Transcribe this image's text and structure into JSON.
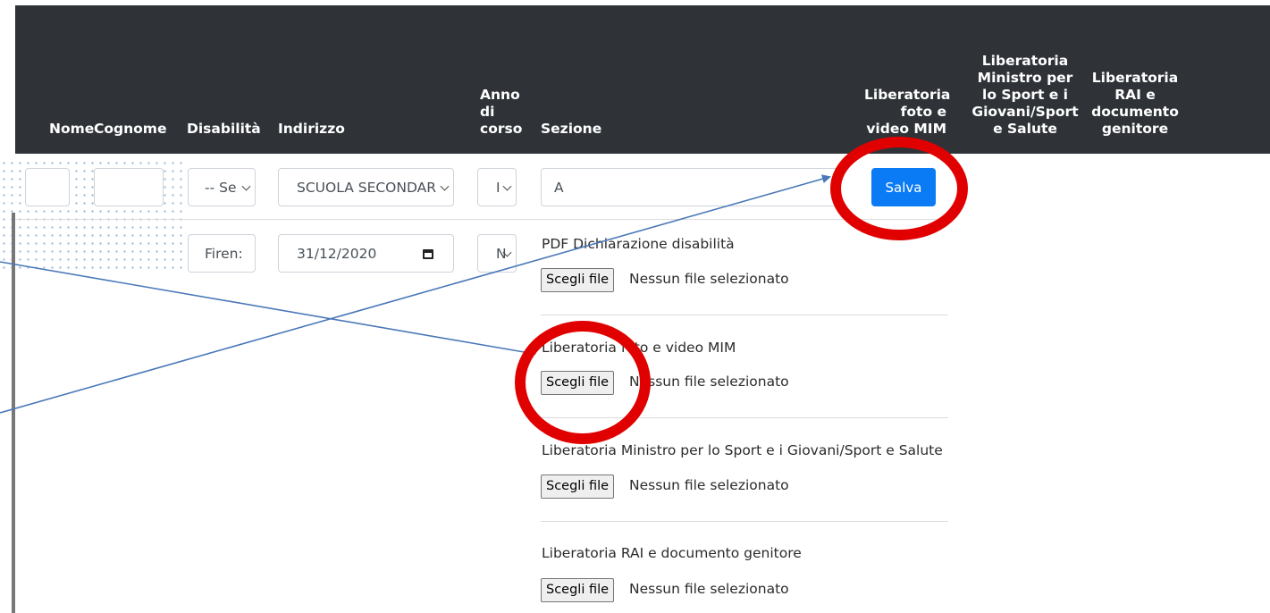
{
  "table": {
    "headers": {
      "nome": "Nome",
      "cognome": "Cognome",
      "disabilita": "Disabilità",
      "indirizzo": "Indirizzo",
      "anno": [
        "Anno",
        "di",
        "corso"
      ],
      "sezione": "Sezione",
      "lib_foto": [
        "Liberatoria",
        "foto e",
        "video MIM"
      ],
      "lib_ministro": [
        "Liberatoria",
        "Ministro per",
        "lo Sport e i",
        "Giovani/Sport",
        "e Salute"
      ],
      "lib_rai": [
        "Liberatoria",
        "RAI e",
        "documento",
        "genitore"
      ]
    },
    "row1": {
      "disabilita_select": "-- Se",
      "indirizzo_select": "SCUOLA SECONDAR",
      "anno_select": "I",
      "sezione_input": "A",
      "save_button": "Salva"
    },
    "row2": {
      "citta_input": "Firen:",
      "date_input": "31/12/2020",
      "anno2_select": "N"
    }
  },
  "uploads": [
    {
      "label": "PDF Dichiarazione disabilità",
      "button": "Scegli file",
      "status": "Nessun file selezionato"
    },
    {
      "label": "Liberatoria foto e video MIM",
      "button": "Scegli file",
      "status": "Nessun file selezionato"
    },
    {
      "label": "Liberatoria Ministro per lo Sport e i Giovani/Sport e Salute",
      "button": "Scegli file",
      "status": "Nessun file selezionato"
    },
    {
      "label": "Liberatoria RAI e documento genitore",
      "button": "Scegli file",
      "status": "Nessun file selezionato"
    }
  ],
  "annotation_colors": {
    "circle": "#e00000",
    "arrow": "#4a78b8"
  }
}
